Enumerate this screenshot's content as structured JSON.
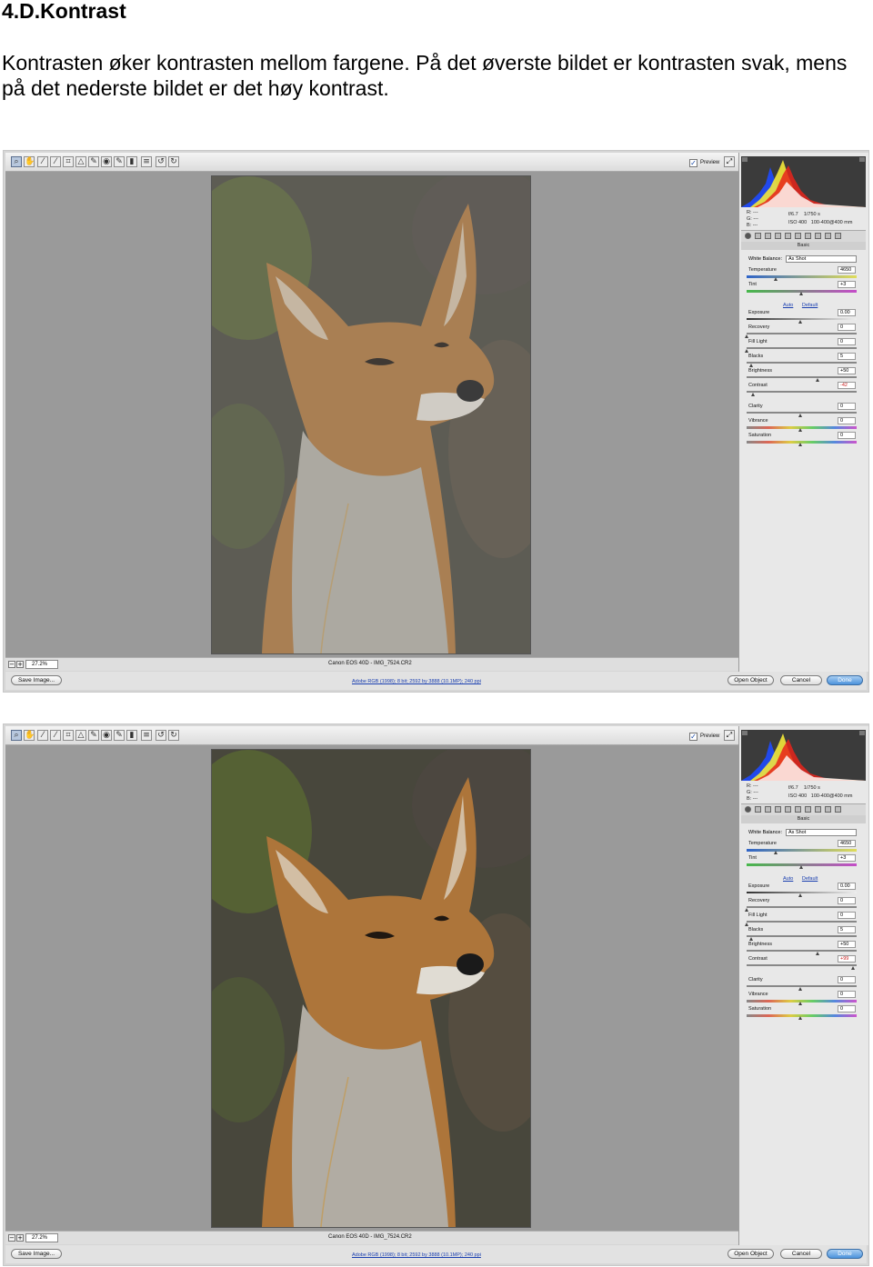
{
  "doc": {
    "heading": "4.D.Kontrast",
    "intro": "Kontrasten øker kontrasten mellom fargene. På det øverste bildet er kontrasten svak, mens på det nederste bildet er det høy kontrast."
  },
  "common": {
    "preview_label": "Preview",
    "zoom": "27.2%",
    "camera_info": "Canon EOS 40D  -  IMG_7524.CR2",
    "workflow_link": "Adobe RGB (1998); 8 bit; 2592 by 3888 (10.1MP); 240 ppi",
    "buttons": {
      "save": "Save Image...",
      "open_object": "Open Object",
      "cancel": "Cancel",
      "done": "Done"
    },
    "readout": {
      "r": "R:  ---",
      "g": "G:  ---",
      "b": "B:  ---",
      "aperture": "f/6.7",
      "shutter": "1/750 s",
      "iso": "ISO 400",
      "lens": "100-400@400 mm"
    },
    "panel_title": "Basic",
    "white_balance_label": "White Balance:",
    "white_balance_value": "As Shot",
    "auto_link": "Auto",
    "default_link": "Default"
  },
  "windows": [
    {
      "contrast_level": "low",
      "sliders": [
        {
          "label": "Temperature",
          "value": "4650",
          "pos": 0.27
        },
        {
          "label": "Tint",
          "value": "+3",
          "pos": 0.51
        },
        {
          "label": "Exposure",
          "value": "0.00",
          "pos": 0.5
        },
        {
          "label": "Recovery",
          "value": "0",
          "pos": 0.0
        },
        {
          "label": "Fill Light",
          "value": "0",
          "pos": 0.0
        },
        {
          "label": "Blacks",
          "value": "5",
          "pos": 0.05
        },
        {
          "label": "Brightness",
          "value": "+50",
          "pos": 0.66
        },
        {
          "label": "Contrast",
          "value": "-42",
          "pos": 0.06
        },
        {
          "label": "Clarity",
          "value": "0",
          "pos": 0.5
        },
        {
          "label": "Vibrance",
          "value": "0",
          "pos": 0.5
        },
        {
          "label": "Saturation",
          "value": "0",
          "pos": 0.5
        }
      ]
    },
    {
      "contrast_level": "high",
      "sliders": [
        {
          "label": "Temperature",
          "value": "4650",
          "pos": 0.27
        },
        {
          "label": "Tint",
          "value": "+3",
          "pos": 0.51
        },
        {
          "label": "Exposure",
          "value": "0.00",
          "pos": 0.5
        },
        {
          "label": "Recovery",
          "value": "0",
          "pos": 0.0
        },
        {
          "label": "Fill Light",
          "value": "0",
          "pos": 0.0
        },
        {
          "label": "Blacks",
          "value": "5",
          "pos": 0.05
        },
        {
          "label": "Brightness",
          "value": "+50",
          "pos": 0.66
        },
        {
          "label": "Contrast",
          "value": "+99",
          "pos": 0.99
        },
        {
          "label": "Clarity",
          "value": "0",
          "pos": 0.5
        },
        {
          "label": "Vibrance",
          "value": "0",
          "pos": 0.5
        },
        {
          "label": "Saturation",
          "value": "0",
          "pos": 0.5
        }
      ]
    }
  ]
}
